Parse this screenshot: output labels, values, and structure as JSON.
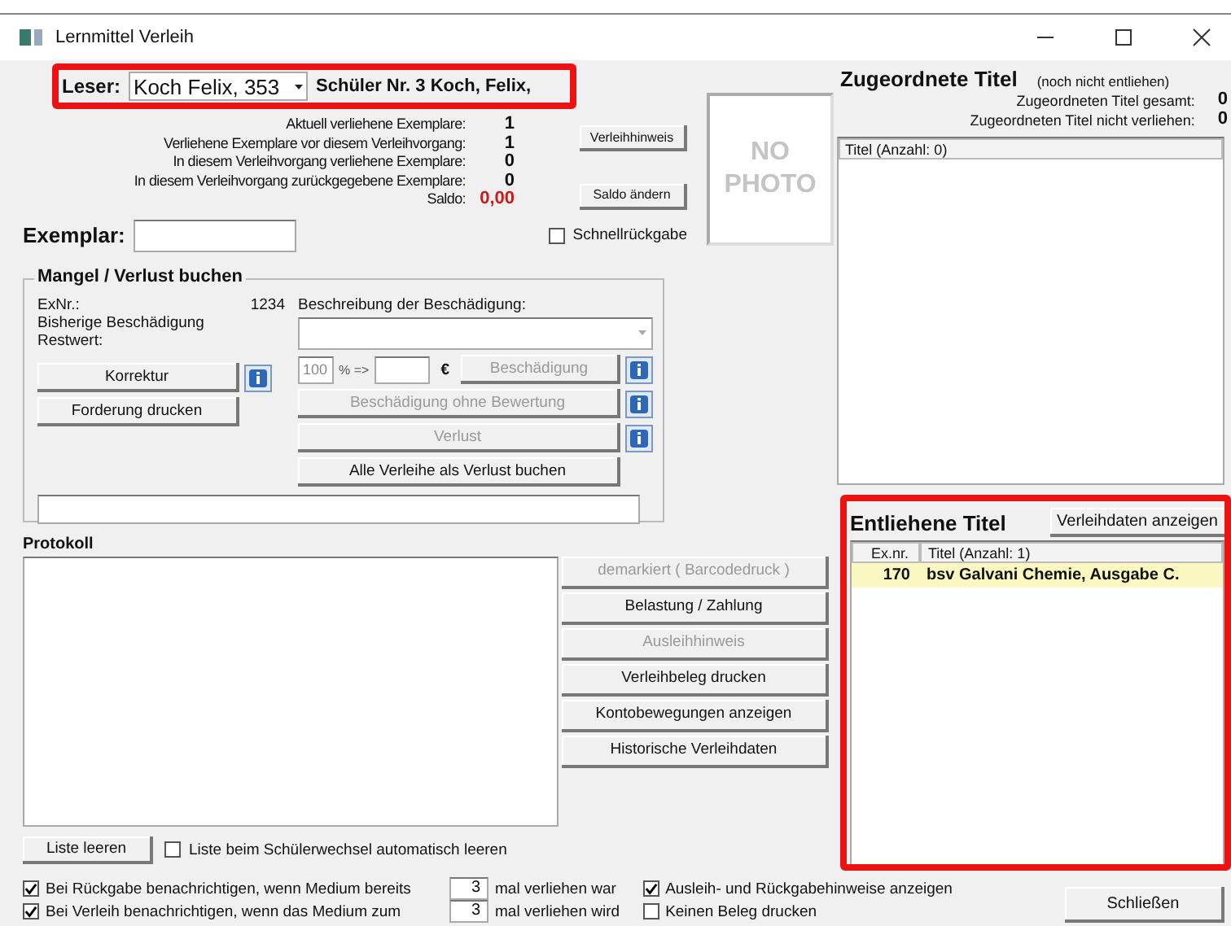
{
  "window": {
    "title": "Lernmittel Verleih"
  },
  "reader": {
    "label": "Leser:",
    "value": "Koch Felix, 353",
    "info": "Schüler Nr. 3 Koch, Felix,"
  },
  "stats": [
    {
      "label": "Aktuell verliehene Exemplare:",
      "value": "1",
      "kind": "count"
    },
    {
      "label": "Verliehene Exemplare vor diesem Verleihvorgang:",
      "value": "1",
      "kind": "count"
    },
    {
      "label": "In diesem Verleihvorgang verliehene Exemplare:",
      "value": "0",
      "kind": "count"
    },
    {
      "label": "In diesem Verleihvorgang zurückgegebene Exemplare:",
      "value": "0",
      "kind": "count"
    },
    {
      "label": "Saldo:",
      "value": "0,00",
      "kind": "money"
    }
  ],
  "side_buttons": [
    "Verleihhinweis",
    "Saldo ändern"
  ],
  "photo": {
    "lines": [
      "NO",
      "PHOTO"
    ]
  },
  "exemplar": {
    "label": "Exemplar:"
  },
  "quick_return": {
    "label": "Schnellrückgabe",
    "checked": false
  },
  "damage": {
    "title": "Mangel / Verlust buchen",
    "fields": [
      {
        "label": "ExNr.:",
        "value": "1234"
      },
      {
        "label": "Bisherige Beschädigung"
      },
      {
        "label": "Restwert:"
      }
    ],
    "left_buttons": [
      {
        "label": "Korrektur",
        "info": true
      },
      {
        "label": "Forderung drucken",
        "info": false
      }
    ],
    "description_label": "Beschreibung der Beschädigung:",
    "percent": "100",
    "percent_sep": "% =>",
    "currency": "€",
    "buttons": [
      {
        "label": "Beschädigung",
        "disabled": true,
        "info": true
      },
      {
        "label": "Beschädigung ohne Bewertung",
        "disabled": true,
        "info": true
      },
      {
        "label": "Verlust",
        "disabled": true,
        "info": true
      },
      {
        "label": "Alle Verleihe als Verlust buchen",
        "disabled": false,
        "info": false
      }
    ]
  },
  "protocol": {
    "title": "Protokoll"
  },
  "actions": [
    {
      "label": "demarkiert ( Barcodedruck )",
      "disabled": true
    },
    {
      "label": "Belastung / Zahlung",
      "disabled": false
    },
    {
      "label": "Ausleihhinweis",
      "disabled": true
    },
    {
      "label": "Verleihbeleg drucken",
      "disabled": false
    },
    {
      "label": "Kontobewegungen anzeigen",
      "disabled": false
    },
    {
      "label": "Historische Verleihdaten",
      "disabled": false
    }
  ],
  "assigned": {
    "title": "Zugeordnete Titel",
    "note": "(noch nicht entliehen)",
    "stats": [
      {
        "label": "Zugeordneten Titel gesamt:",
        "value": "0"
      },
      {
        "label": "Zugeordneten Titel nicht verliehen:",
        "value": "0"
      }
    ],
    "list_header": "Titel (Anzahl: 0)"
  },
  "loaned": {
    "title": "Entliehene Titel",
    "button": "Verleihdaten anzeigen",
    "columns": [
      "Ex.nr.",
      "Titel (Anzahl: 1)"
    ],
    "rows": [
      {
        "exnr": "170",
        "title": "bsv Galvani Chemie, Ausgabe C.",
        "selected": true
      }
    ]
  },
  "clear_button": "Liste leeren",
  "auto_clear": {
    "label": "Liste beim Schülerwechsel automatisch leeren",
    "checked": false
  },
  "notify": [
    {
      "label": "Bei Rückgabe benachrichtigen, wenn Medium bereits",
      "count": "3",
      "suffix": "mal verliehen war",
      "checked": true
    },
    {
      "label": "Bei Verleih benachrichtigen, wenn das Medium zum",
      "count": "3",
      "suffix": "mal verliehen wird",
      "checked": true
    }
  ],
  "options": [
    {
      "label": "Ausleih- und Rückgabehinweise anzeigen",
      "checked": true
    },
    {
      "label": "Keinen Beleg drucken",
      "checked": false
    }
  ],
  "close_button": "Schließen"
}
